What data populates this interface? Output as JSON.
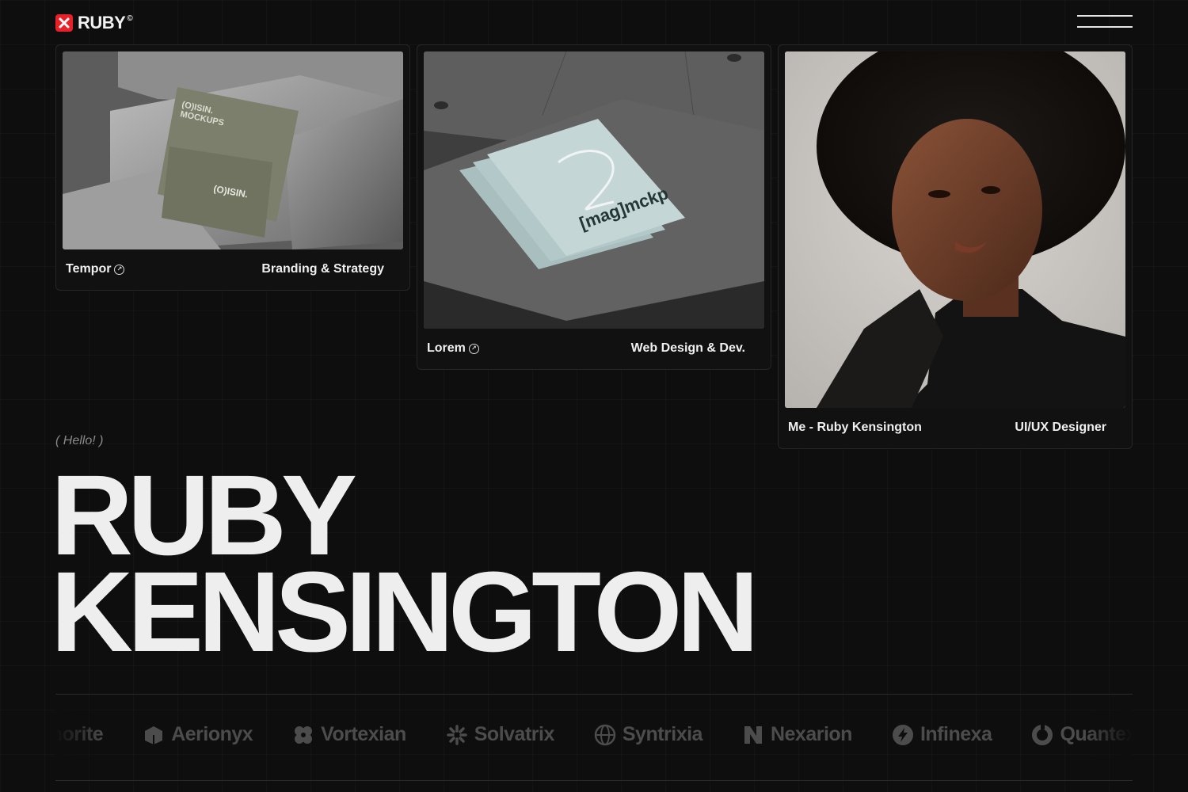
{
  "header": {
    "logo_text": "RUBY",
    "logo_registered": "©",
    "menu_icon": "hamburger-icon"
  },
  "colors": {
    "background": "#0e0e0e",
    "brand_red": "#e8202a",
    "text": "#efefef",
    "muted_text": "#8a8a8a",
    "client_logo_gray": "#4c4c4c"
  },
  "projects": [
    {
      "name": "Tempor",
      "category": "Branding & Strategy",
      "image": "business-card-mockup on concrete",
      "mockup_text_1": "(O)ISIN.",
      "mockup_text_2": "MOCKUPS",
      "mockup_text_3": "(O)ISIN."
    },
    {
      "name": "Lorem",
      "category": "Web Design & Dev.",
      "image": "magazine-mockup on stone",
      "mockup_text": "[mag]mckp"
    },
    {
      "name": "Me - Ruby Kensington",
      "category": "UI/UX Designer",
      "image": "portrait photo"
    }
  ],
  "hero": {
    "hello": "( Hello! )",
    "first_name": "RUBY",
    "last_name": "KENSINGTON"
  },
  "clients": [
    {
      "name": "umorite",
      "icon": "none"
    },
    {
      "name": "Aerionyx",
      "icon": "cube-icon"
    },
    {
      "name": "Vortexian",
      "icon": "pinwheel-icon"
    },
    {
      "name": "Solvatrix",
      "icon": "sunburst-icon"
    },
    {
      "name": "Syntrixia",
      "icon": "globe-icon"
    },
    {
      "name": "Nexarion",
      "icon": "n-logo-icon"
    },
    {
      "name": "Infinexa",
      "icon": "bolt-icon"
    },
    {
      "name": "Quantexia",
      "icon": "ring-icon"
    }
  ]
}
